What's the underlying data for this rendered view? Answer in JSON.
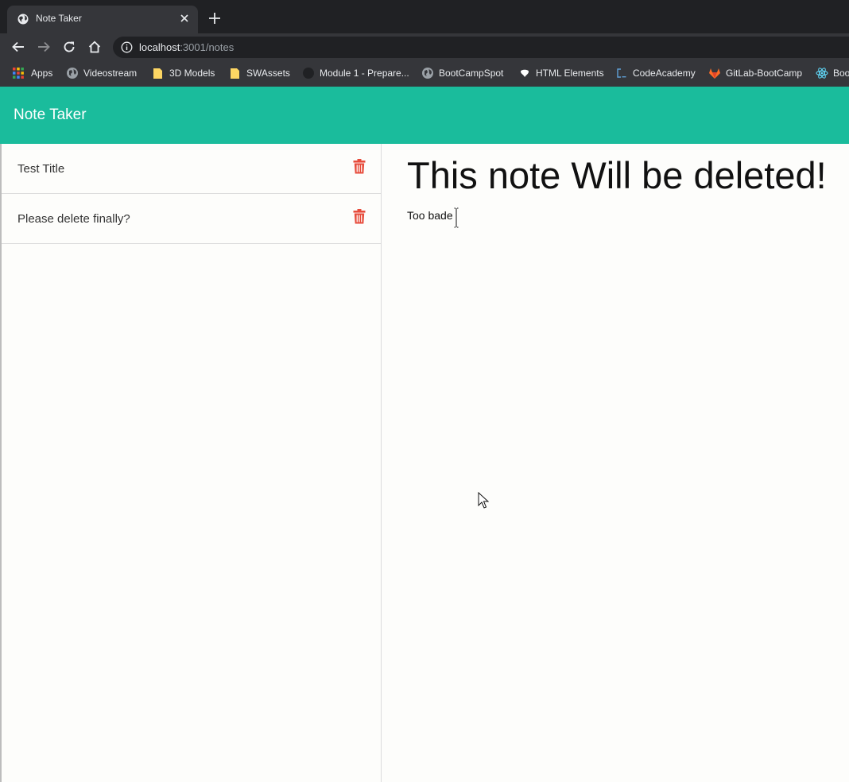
{
  "browser": {
    "tab_title": "Note Taker",
    "url_host": "localhost",
    "url_path": ":3001/notes",
    "icons": {
      "favicon": "globe-icon",
      "close": "close-icon",
      "new_tab": "plus-icon",
      "back": "back-arrow-icon",
      "forward": "forward-arrow-icon",
      "reload": "reload-icon",
      "home": "home-icon",
      "info": "info-icon"
    },
    "bookmarks": [
      {
        "label": "Apps",
        "icon": "apps-grid-icon"
      },
      {
        "label": "Videostream",
        "icon": "globe-icon"
      },
      {
        "label": "3D Models",
        "icon": "folder-icon"
      },
      {
        "label": "SWAssets",
        "icon": "folder-icon"
      },
      {
        "label": "Module 1 - Prepare...",
        "icon": "github-icon"
      },
      {
        "label": "BootCampSpot",
        "icon": "globe-icon"
      },
      {
        "label": "HTML Elements",
        "icon": "bookmark-logo-icon"
      },
      {
        "label": "CodeAcademy",
        "icon": "codecademy-icon"
      },
      {
        "label": "GitLab-BootCamp",
        "icon": "gitlab-icon"
      },
      {
        "label": "Boo",
        "icon": "react-icon"
      }
    ]
  },
  "app": {
    "brand": "Note Taker",
    "accent_color": "#1abc9c",
    "delete_color": "#e74c3c",
    "notes": [
      {
        "title": "Test Title"
      },
      {
        "title": "Please delete finally?"
      }
    ],
    "active_note": {
      "title": "This note Will be deleted!",
      "text": "Too bade"
    }
  }
}
